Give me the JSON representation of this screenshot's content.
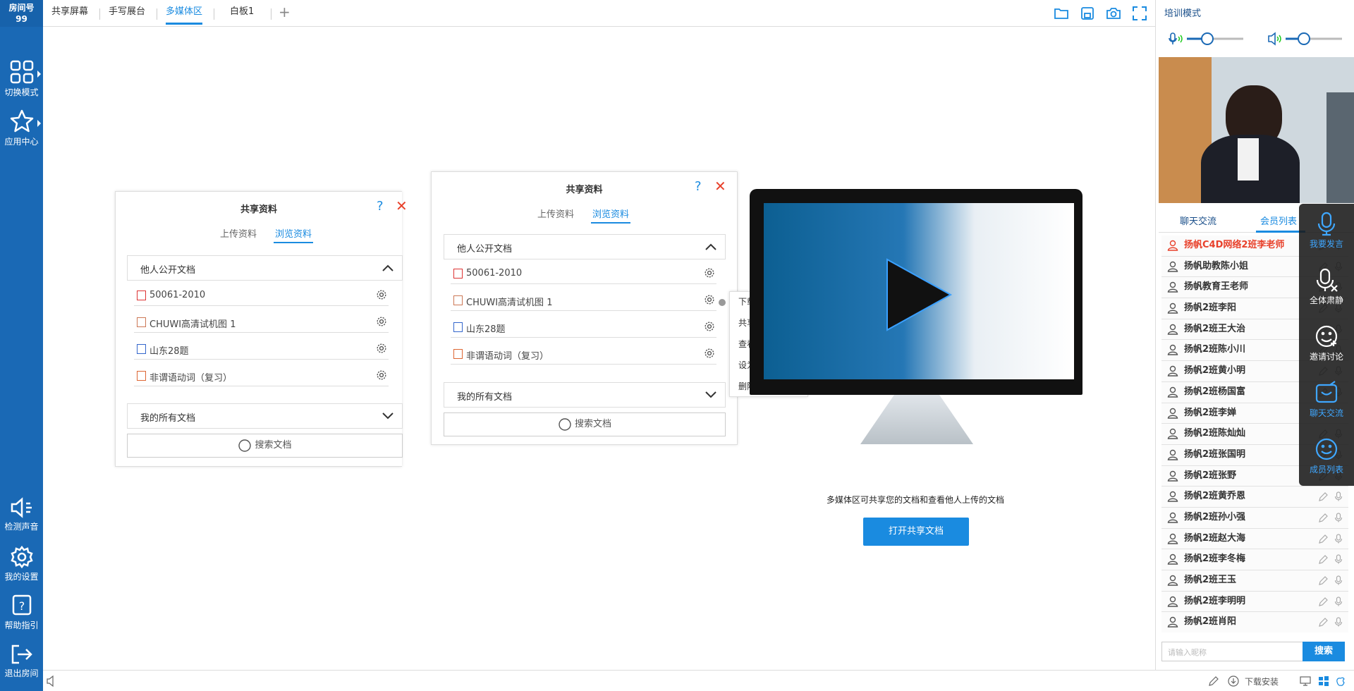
{
  "room": {
    "label": "房间号",
    "number": "99"
  },
  "left_nav": [
    {
      "label": "切换模式"
    },
    {
      "label": "应用中心"
    },
    {
      "label": "检测声音"
    },
    {
      "label": "我的设置"
    },
    {
      "label": "帮助指引"
    },
    {
      "label": "退出房间"
    }
  ],
  "tabs": [
    {
      "label": "共享屏幕"
    },
    {
      "label": "手写展台"
    },
    {
      "label": "多媒体区",
      "active": true
    },
    {
      "label": "白板1"
    }
  ],
  "add_tab_label": "+",
  "right_panel": {
    "mode": "培训模式",
    "tabs": [
      "聊天交流",
      "会员列表"
    ],
    "members": [
      {
        "name": "扬帆C4D网络2班李老师",
        "highlight": true
      },
      {
        "name": "扬帆助教陈小姐"
      },
      {
        "name": "扬帆教育王老师"
      },
      {
        "name": "扬帆2班李阳"
      },
      {
        "name": "扬帆2班王大治"
      },
      {
        "name": "扬帆2班陈小川"
      },
      {
        "name": "扬帆2班黄小明"
      },
      {
        "name": "扬帆2班杨国富"
      },
      {
        "name": "扬帆2班李婵"
      },
      {
        "name": "扬帆2班陈灿灿"
      },
      {
        "name": "扬帆2班张国明"
      },
      {
        "name": "扬帆2班张野"
      },
      {
        "name": "扬帆2班黄乔恩"
      },
      {
        "name": "扬帆2班孙小强"
      },
      {
        "name": "扬帆2班赵大海"
      },
      {
        "name": "扬帆2班李冬梅"
      },
      {
        "name": "扬帆2班王玉"
      },
      {
        "name": "扬帆2班李明明"
      },
      {
        "name": "扬帆2班肖阳"
      }
    ],
    "search_placeholder": "请输入昵称",
    "search_button": "搜索"
  },
  "float_toolbar": [
    {
      "label": "我要发言"
    },
    {
      "label": "全体肃静"
    },
    {
      "label": "邀请讨论"
    },
    {
      "label": "聊天交流"
    },
    {
      "label": "成员列表"
    }
  ],
  "panel_left": {
    "title": "共享资料",
    "help": "?",
    "close": "✕",
    "tabs": [
      "上传资料",
      "浏览资料"
    ],
    "section_public": "他人公开文档",
    "files": [
      {
        "name": "50061-2010",
        "type": "pdf"
      },
      {
        "name": "CHUWI高清试机图 1",
        "type": "img"
      },
      {
        "name": "山东28题",
        "type": "word"
      },
      {
        "name": "非谓语动词（复习）",
        "type": "ppt"
      }
    ],
    "section_mine": "我的所有文档",
    "search": "搜索文档"
  },
  "panel_center": {
    "title": "共享资料",
    "help": "?",
    "close": "✕",
    "tabs": [
      "上传资料",
      "浏览资料"
    ],
    "section_public": "他人公开文档",
    "files": [
      {
        "name": "50061-2010",
        "type": "pdf"
      },
      {
        "name": "CHUWI高清试机图 1",
        "type": "img"
      },
      {
        "name": "山东28题",
        "type": "word"
      },
      {
        "name": "非谓语动词（复习）",
        "type": "ppt"
      }
    ],
    "section_mine": "我的所有文档",
    "search": "搜索文档"
  },
  "context_menu": [
    "下载文件",
    "共享文件",
    "查看文件",
    "设为私有",
    "删除文件"
  ],
  "media": {
    "caption": "多媒体区可共享您的文档和查看他人上传的文档",
    "open_button": "打开共享文档"
  },
  "status_bar": {
    "download": "下载安装"
  },
  "colors": {
    "sidebar": "#1a69b5",
    "accent": "#1a8be0",
    "close": "#e8402a",
    "highlight_member": "#e8402a"
  }
}
